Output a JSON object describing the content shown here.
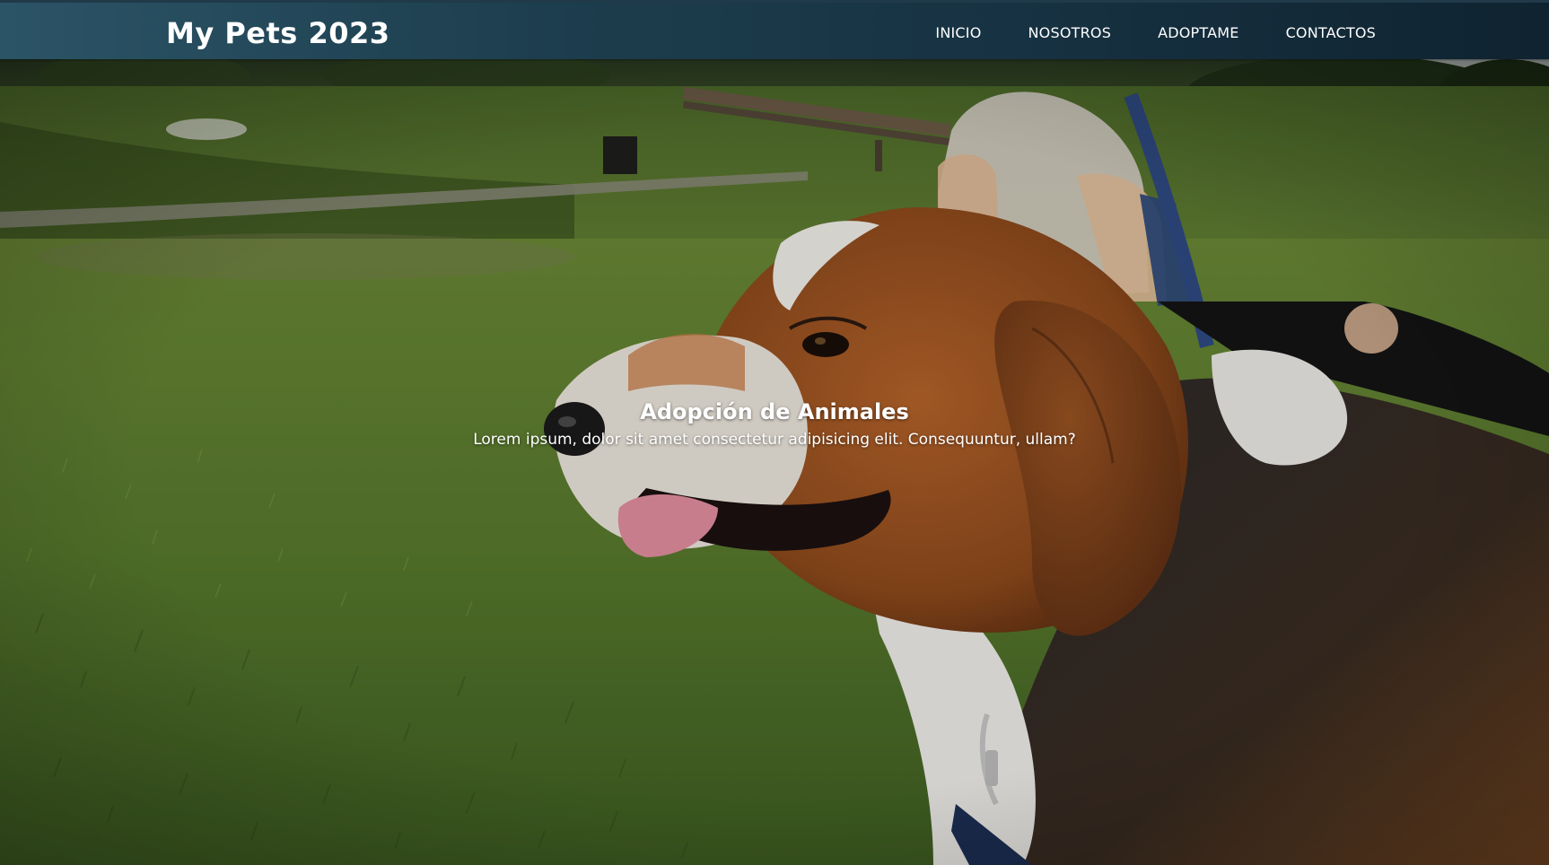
{
  "header": {
    "brand": "My Pets 2023",
    "nav": [
      "INICIO",
      "NOSOTROS",
      "ADOPTAME",
      "CONTACTOS"
    ]
  },
  "hero": {
    "title": "Adopción de Animales",
    "subtitle": "Lorem ipsum, dolor sit amet consectetur adipisicing elit. Consequuntur, ullam?",
    "background_description": "beagle dog on grass in a park",
    "overlay_color": "#000000"
  },
  "colors": {
    "header_start": "#2b5466",
    "header_end": "#0f2330",
    "text": "#ffffff",
    "grass": "#5a7a32"
  }
}
